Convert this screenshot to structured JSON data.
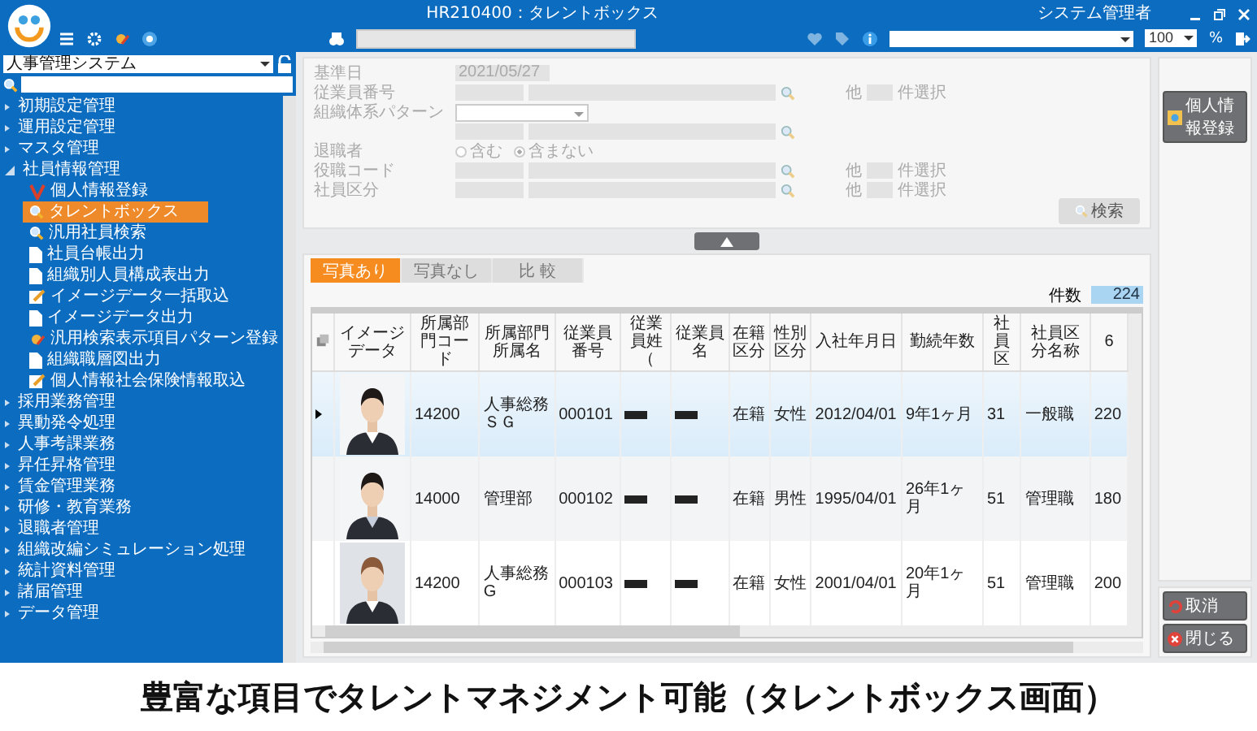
{
  "header": {
    "title": "HR210400：タレントボックス",
    "user": "システム管理者",
    "zoom": "100",
    "zoom_unit": "%"
  },
  "sidebar": {
    "system": "人事管理システム",
    "tree": [
      {
        "label": "初期設定管理",
        "expanded": false
      },
      {
        "label": "運用設定管理",
        "expanded": false
      },
      {
        "label": "マスタ管理",
        "expanded": false
      },
      {
        "label": "社員情報管理",
        "expanded": true,
        "children": [
          {
            "label": "個人情報登録",
            "kind": "register",
            "selected": false
          },
          {
            "label": "タレントボックス",
            "kind": "search",
            "selected": true
          },
          {
            "label": "汎用社員検索",
            "kind": "search",
            "selected": false
          },
          {
            "label": "社員台帳出力",
            "kind": "doc",
            "selected": false
          },
          {
            "label": "組織別人員構成表出力",
            "kind": "doc",
            "selected": false
          },
          {
            "label": "イメージデータ一括取込",
            "kind": "import",
            "selected": false
          },
          {
            "label": "イメージデータ出力",
            "kind": "doc",
            "selected": false
          },
          {
            "label": "汎用検索表示項目パターン登録",
            "kind": "pattern",
            "selected": false
          },
          {
            "label": "組織職層図出力",
            "kind": "doc",
            "selected": false
          },
          {
            "label": "個人情報社会保険情報取込",
            "kind": "import",
            "selected": false
          }
        ]
      },
      {
        "label": "採用業務管理",
        "expanded": false
      },
      {
        "label": "異動発令処理",
        "expanded": false
      },
      {
        "label": "人事考課業務",
        "expanded": false
      },
      {
        "label": "昇任昇格管理",
        "expanded": false
      },
      {
        "label": "賃金管理業務",
        "expanded": false
      },
      {
        "label": "研修・教育業務",
        "expanded": false
      },
      {
        "label": "退職者管理",
        "expanded": false
      },
      {
        "label": "組織改編シミュレーション処理",
        "expanded": false
      },
      {
        "label": "統計資料管理",
        "expanded": false
      },
      {
        "label": "諸届管理",
        "expanded": false
      },
      {
        "label": "データ管理",
        "expanded": false
      }
    ]
  },
  "form": {
    "fields": [
      {
        "kind": "text",
        "label": "基準日",
        "value": "2021/05/27"
      },
      {
        "kind": "lookup",
        "label": "従業員番号",
        "other": "他",
        "count_label": "件選択"
      },
      {
        "kind": "select",
        "label": "組織体系パターン"
      },
      {
        "kind": "lookup"
      },
      {
        "kind": "radio",
        "label": "退職者",
        "options": [
          {
            "label": "含む",
            "selected": false
          },
          {
            "label": "含まない",
            "selected": true
          }
        ]
      },
      {
        "kind": "lookup",
        "label": "役職コード",
        "other": "他",
        "count_label": "件選択"
      },
      {
        "kind": "lookup",
        "label": "社員区分",
        "other": "他",
        "count_label": "件選択"
      }
    ],
    "search_button": "検索"
  },
  "tabs": [
    {
      "label": "写真あり",
      "selected": true
    },
    {
      "label": "写真なし",
      "selected": false
    },
    {
      "label": "比 較",
      "selected": false
    }
  ],
  "count": {
    "label": "件数",
    "value": "224"
  },
  "table": {
    "image_column": "イメージデータ",
    "columns": [
      "所属部門コード",
      "所属部門所属名",
      "従業員番号",
      "従業員姓（",
      "従業員名",
      "在籍区分",
      "性別区分",
      "入社年月日",
      "勤続年数",
      "社員区",
      "社員区分名称",
      "6"
    ],
    "rows": [
      {
        "selected": true,
        "cells": [
          "14200",
          "人事総務ＳＧ",
          "000101",
          "",
          "",
          "在籍",
          "女性",
          "2012/04/01",
          "9年1ヶ月",
          "31",
          "一般職",
          "220"
        ]
      },
      {
        "selected": false,
        "cells": [
          "14000",
          "管理部",
          "000102",
          "",
          "",
          "在籍",
          "男性",
          "1995/04/01",
          "26年1ヶ月",
          "51",
          "管理職",
          "180"
        ]
      },
      {
        "selected": false,
        "cells": [
          "14200",
          "人事総務G",
          "000103",
          "",
          "",
          "在籍",
          "女性",
          "2001/04/01",
          "20年1ヶ月",
          "51",
          "管理職",
          "200"
        ]
      }
    ]
  },
  "side_actions": {
    "top": [
      "個人情報登録"
    ],
    "bottom": [
      {
        "kind": "cancel",
        "label": "取消"
      },
      {
        "kind": "close",
        "label": "閉じる"
      }
    ]
  },
  "caption": "豊富な項目でタレントマネジメント可能（タレントボックス画面）"
}
